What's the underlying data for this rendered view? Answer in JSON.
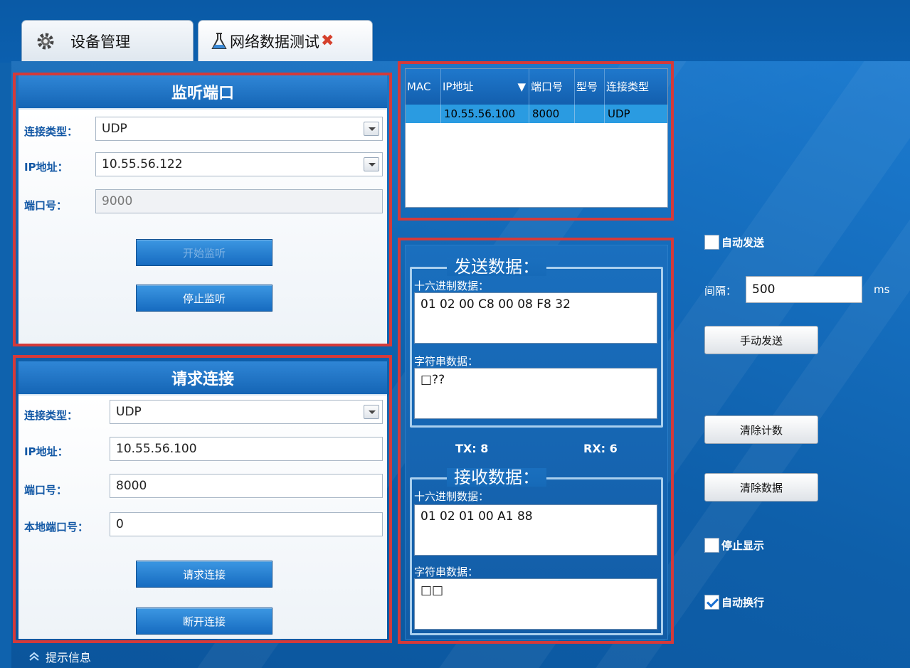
{
  "tabs": [
    {
      "label": "设备管理",
      "icon": "gear-icon"
    },
    {
      "label": "网络数据测试",
      "icon": "flask-icon",
      "close_icon": "close-icon"
    }
  ],
  "listen_panel": {
    "title": "监听端口",
    "conn_type_label": "连接类型：",
    "conn_type_value": "UDP",
    "ip_label": "IP地址：",
    "ip_value": "10.55.56.122",
    "port_label": "端口号：",
    "port_value": "9000",
    "start_button": "开始监听",
    "stop_button": "停止监听"
  },
  "connect_panel": {
    "title": "请求连接",
    "conn_type_label": "连接类型：",
    "conn_type_value": "UDP",
    "ip_label": "IP地址：",
    "ip_value": "10.55.56.100",
    "port_label": "端口号：",
    "port_value": "8000",
    "local_port_label": "本地端口号：",
    "local_port_value": "0",
    "connect_button": "请求连接",
    "disconnect_button": "断开连接"
  },
  "device_grid": {
    "columns": [
      "MAC",
      "IP地址",
      "端口号",
      "型号",
      "连接类型"
    ],
    "sort_indicator": "▼",
    "rows": [
      {
        "mac": "",
        "ip": "10.55.56.100",
        "port": "8000",
        "model": "",
        "conn_type": "UDP"
      }
    ]
  },
  "send_data": {
    "title": "发送数据：",
    "hex_label": "十六进制数据：",
    "hex_value": "01 02 00 C8 00 08 F8 32",
    "str_label": "字符串数据：",
    "str_value": "□??"
  },
  "counters": {
    "tx": "TX: 8",
    "rx": "RX: 6"
  },
  "receive_data": {
    "title": "接收数据：",
    "hex_label": "十六进制数据：",
    "hex_value": "01 02 01 00 A1 88",
    "str_label": "字符串数据：",
    "str_value": "□□"
  },
  "controls": {
    "auto_send_label": "自动发送",
    "auto_send_checked": false,
    "interval_label": "间隔：",
    "interval_value": "500",
    "interval_unit": "ms",
    "manual_send": "手动发送",
    "clear_count": "清除计数",
    "clear_data": "清除数据",
    "stop_display_label": "停止显示",
    "stop_display_checked": false,
    "auto_wrap_label": "自动换行",
    "auto_wrap_checked": true
  },
  "status": {
    "label": "提示信息",
    "icon": "chevron-up-icon"
  },
  "colors": {
    "accent_red": "#d43a3a",
    "header_blue": "#1565b5",
    "background_blue": "#0f62ad"
  }
}
